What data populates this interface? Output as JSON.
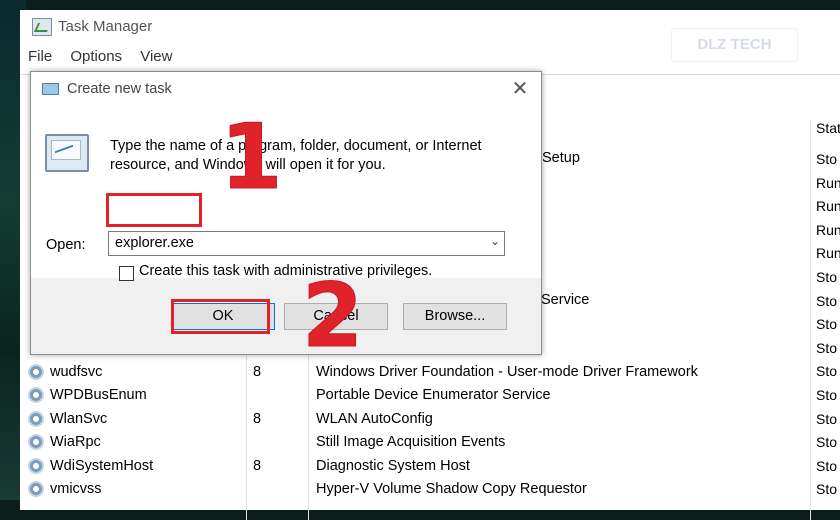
{
  "window": {
    "title": "Task Manager",
    "watermark": "DLZ TECH",
    "menu": [
      "File",
      "Options",
      "View"
    ]
  },
  "columns": {
    "status_header": "Stat"
  },
  "status_values": [
    "Sto",
    "Run",
    "Run",
    "Run",
    "Run",
    "Sto",
    "Sto",
    "Sto",
    "Sto",
    "Sto",
    "Sto",
    "Sto",
    "Sto",
    "Sto",
    "Sto"
  ],
  "behind_dialog": {
    "row1_desc_fragment": "Setup",
    "row2_desc_fragment": "Service"
  },
  "services": [
    {
      "name": "wudfsvc",
      "pid": "8",
      "desc": "Windows Driver Foundation - User-mode Driver Framework"
    },
    {
      "name": "WPDBusEnum",
      "pid": "",
      "desc": "Portable Device Enumerator Service"
    },
    {
      "name": "WlanSvc",
      "pid": "8",
      "desc": "WLAN AutoConfig"
    },
    {
      "name": "WiaRpc",
      "pid": "",
      "desc": "Still Image Acquisition Events"
    },
    {
      "name": "WdiSystemHost",
      "pid": "8",
      "desc": "Diagnostic System Host"
    },
    {
      "name": "vmicvss",
      "pid": "",
      "desc": "Hyper-V Volume Shadow Copy Requestor"
    }
  ],
  "dialog": {
    "title": "Create new task",
    "close": "✕",
    "description": "Type the name of a program, folder, document, or Internet resource, and Windows will open it for you.",
    "open_label": "Open:",
    "open_value": "explorer.exe",
    "dropdown_glyph": "⌄",
    "admin_checkbox_label": "Create this task with administrative privileges.",
    "admin_checked": false,
    "ok_label": "OK",
    "cancel_label": "Cancel",
    "browse_label": "Browse..."
  },
  "annotations": {
    "step1": "1",
    "step2": "2",
    "color": "#e0232b"
  }
}
